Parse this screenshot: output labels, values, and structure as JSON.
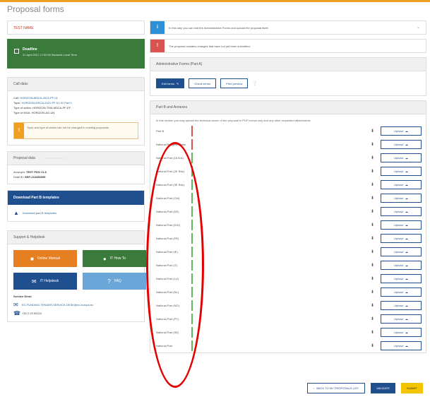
{
  "page": {
    "title": "Proposal forms"
  },
  "colors": {
    "accent": "#1f4f8f",
    "deadline": "#3a7a3a",
    "warning": "#f0a020",
    "info": "#2d8fd6",
    "danger": "#d9534f",
    "submit": "#f5c400",
    "annotation": "#e30000"
  },
  "sidebar": {
    "title_field": "TEST NAME",
    "deadline": {
      "label": "Deadline",
      "date": "21 April 2021 17:00:00 Brussels Local Time",
      "icon": "calendar-icon"
    },
    "call": {
      "heading": "Call data:",
      "call_label": "Call:",
      "call_value": "HORIZON-MSCA-2021-PF-01",
      "topic_label": "Topic:",
      "topic_value": "HORIZON-MSCA-2021-PF-01-01 Part 1",
      "type_action_label": "Type of action:",
      "type_action_value": "HORIZON-TMA-MSCA-PF-EF",
      "type_mga_label": "Type of MGA:",
      "type_mga_value": "HORIZON-AG-UN",
      "warning": "Topic and type of action can not be changed in existing proposals."
    },
    "proposal": {
      "heading": "Proposal data",
      "pill": "",
      "acronym_label": "Acronym:",
      "acronym_value": "TEST PDG CL8",
      "draft_label": "Draft ID:",
      "draft_value": "SEP-210456095"
    },
    "templates": {
      "heading": "Download Part B templates",
      "link": "Download part B templates"
    },
    "support": {
      "heading": "Support & Helpdesk",
      "buttons": [
        {
          "label": "Online Manual",
          "icon": "book-icon",
          "color": "#e67e22"
        },
        {
          "label": "IT How To",
          "icon": "info-icon",
          "color": "#3a7a3a"
        },
        {
          "label": "IT Helpdesk",
          "icon": "envelope-icon",
          "color": "#1f4f8f"
        },
        {
          "label": "FAQ",
          "icon": "question-icon",
          "color": "#6aa6d8"
        }
      ],
      "service_desk": "Service Desk:",
      "email": "EC-FUNDING-TENDER-SERVICE-DESK@ec.europa.eu",
      "phone": "+32 2 29 92222"
    }
  },
  "main": {
    "info_alert": "In this step you can edit the Administrative Forms and upload the proposal itself.",
    "danger_alert": "The proposal contains changes that have not yet been submitted.",
    "admin": {
      "heading": "Administrative Forms (Part A)",
      "edit_label": "Edit forms",
      "edit_icon": "pencil-icon",
      "buttons": [
        "Check errors",
        "Print preview"
      ],
      "help_icon": "question-icon"
    },
    "annexes": {
      "heading": "Part B and Annexes",
      "note": "In this section you may upload the technical annex of the proposal in PDF format only and any other requested attachments",
      "upload_label": "Upload",
      "rows": [
        {
          "label": "Part B",
          "status": "#d9534f"
        },
        {
          "label": "National Budgetin Table",
          "status": "#d9534f"
        },
        {
          "label": "National Part (18 IEA)",
          "status": "#5cb85c"
        },
        {
          "label": "National Part (2E Rdc)",
          "status": "#5cb85c"
        },
        {
          "label": "National Part (3E Rdc)",
          "status": "#5cb85c"
        },
        {
          "label": "National Part (CM)",
          "status": "#5cb85c"
        },
        {
          "label": "National Part (DE)",
          "status": "#5cb85c"
        },
        {
          "label": "National Part (DIG)",
          "status": "#5cb85c"
        },
        {
          "label": "National Part (FR)",
          "status": "#5cb85c"
        },
        {
          "label": "National Part (IE)",
          "status": "#5cb85c"
        },
        {
          "label": "National Part (IT)",
          "status": "#5cb85c"
        },
        {
          "label": "National Part (LU)",
          "status": "#5cb85c"
        },
        {
          "label": "National Part (NL)",
          "status": "#5cb85c"
        },
        {
          "label": "National Part (NO)",
          "status": "#5cb85c"
        },
        {
          "label": "National Part (PT)",
          "status": "#5cb85c"
        },
        {
          "label": "National Part (SE)",
          "status": "#5cb85c"
        },
        {
          "label": "National Part",
          "status": "#5cb85c"
        }
      ]
    }
  },
  "footer": {
    "back": "BACK TO MY PROPOSALS LIST",
    "validate": "VALIDATE",
    "submit": "SUBMIT"
  }
}
